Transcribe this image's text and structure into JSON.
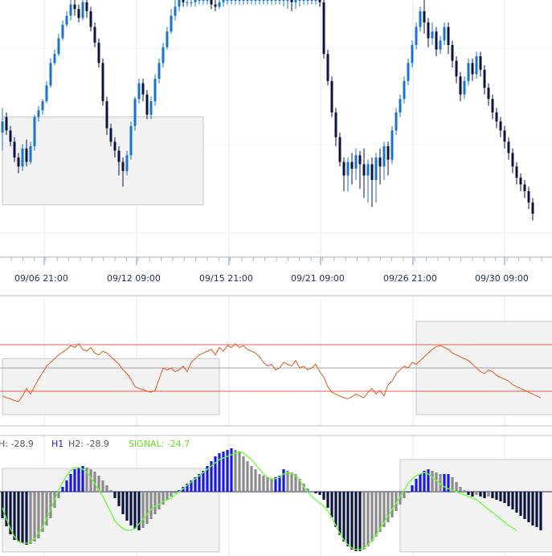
{
  "chart_data": [
    {
      "type": "candlestick",
      "x_tick_labels": [
        "09/06 21:00",
        "09/12 09:00",
        "09/15 21:00",
        "09/21 09:00",
        "09/26 21:00",
        "09/30 09:00"
      ],
      "colors": {
        "up": "#1874cd",
        "down": "#0b1445",
        "zone": "#f2f2f2",
        "zone_border": "#c8c8c8",
        "grid": "#e4e8ee"
      },
      "zones": [
        {
          "x_from": 0,
          "x_to": 50,
          "y_from": 9,
          "y_to": 48
        },
        {
          "x_from": 143,
          "x_to": 200,
          "y_from": 24,
          "y_to": 46
        }
      ],
      "candles": [
        [
          41,
          46,
          33,
          52
        ],
        [
          48,
          42,
          40,
          50
        ],
        [
          42,
          37,
          35,
          44
        ],
        [
          37,
          30,
          28,
          39
        ],
        [
          30,
          26,
          23,
          32
        ],
        [
          26,
          34,
          24,
          36
        ],
        [
          34,
          28,
          26,
          38
        ],
        [
          28,
          35,
          27,
          37
        ],
        [
          35,
          48,
          33,
          49
        ],
        [
          48,
          51,
          46,
          53
        ],
        [
          51,
          55,
          49,
          56
        ],
        [
          55,
          62,
          54,
          64
        ],
        [
          62,
          72,
          61,
          74
        ],
        [
          72,
          76,
          71,
          78
        ],
        [
          76,
          83,
          75,
          85
        ],
        [
          83,
          89,
          82,
          91
        ],
        [
          89,
          93,
          88,
          95
        ],
        [
          93,
          98,
          91,
          100
        ],
        [
          98,
          96,
          93,
          100
        ],
        [
          96,
          92,
          90,
          98
        ],
        [
          92,
          99,
          91,
          100
        ],
        [
          99,
          95,
          92,
          100
        ],
        [
          95,
          88,
          86,
          97
        ],
        [
          88,
          81,
          79,
          90
        ],
        [
          81,
          72,
          70,
          83
        ],
        [
          72,
          55,
          53,
          74
        ],
        [
          55,
          43,
          40,
          57
        ],
        [
          43,
          37,
          35,
          45
        ],
        [
          37,
          33,
          30,
          39
        ],
        [
          33,
          28,
          22,
          35
        ],
        [
          28,
          24,
          17,
          30
        ],
        [
          24,
          31,
          22,
          33
        ],
        [
          31,
          44,
          29,
          46
        ],
        [
          44,
          56,
          42,
          57
        ],
        [
          56,
          63,
          54,
          65
        ],
        [
          63,
          58,
          55,
          65
        ],
        [
          58,
          49,
          47,
          60
        ],
        [
          49,
          55,
          47,
          57
        ],
        [
          55,
          65,
          53,
          67
        ],
        [
          65,
          72,
          63,
          74
        ],
        [
          72,
          79,
          70,
          81
        ],
        [
          79,
          86,
          78,
          88
        ],
        [
          86,
          93,
          85,
          96
        ],
        [
          93,
          97,
          91,
          100
        ],
        [
          97,
          100,
          95,
          100
        ],
        [
          100,
          99,
          97,
          100
        ],
        [
          99,
          99,
          97,
          100
        ],
        [
          99,
          99,
          97,
          100
        ],
        [
          99,
          100,
          97,
          100
        ],
        [
          100,
          100,
          98,
          100
        ],
        [
          100,
          100,
          98,
          100
        ],
        [
          100,
          100,
          98,
          100
        ],
        [
          100,
          98,
          96,
          100
        ],
        [
          98,
          97,
          95,
          100
        ],
        [
          97,
          99,
          96,
          100
        ],
        [
          99,
          100,
          97,
          100
        ],
        [
          100,
          100,
          98,
          100
        ],
        [
          100,
          100,
          98,
          100
        ],
        [
          100,
          100,
          98,
          100
        ],
        [
          100,
          100,
          98,
          100
        ],
        [
          100,
          100,
          98,
          100
        ],
        [
          100,
          100,
          98,
          100
        ],
        [
          100,
          100,
          98,
          100
        ],
        [
          100,
          100,
          98,
          100
        ],
        [
          100,
          100,
          98,
          100
        ],
        [
          100,
          100,
          98,
          100
        ],
        [
          100,
          100,
          98,
          100
        ],
        [
          100,
          100,
          98,
          100
        ],
        [
          100,
          100,
          98,
          100
        ],
        [
          100,
          100,
          98,
          100
        ],
        [
          100,
          100,
          97,
          100
        ],
        [
          100,
          100,
          96,
          100
        ],
        [
          100,
          99,
          95,
          100
        ],
        [
          99,
          100,
          96,
          100
        ],
        [
          100,
          100,
          97,
          100
        ],
        [
          100,
          100,
          98,
          100
        ],
        [
          100,
          100,
          98,
          100
        ],
        [
          100,
          100,
          98,
          100
        ],
        [
          100,
          100,
          98,
          100
        ],
        [
          100,
          99,
          97,
          100
        ],
        [
          99,
          76,
          74,
          100
        ],
        [
          76,
          64,
          62,
          78
        ],
        [
          64,
          50,
          48,
          66
        ],
        [
          50,
          39,
          35,
          52
        ],
        [
          39,
          28,
          26,
          41
        ],
        [
          28,
          22,
          15,
          30
        ],
        [
          22,
          28,
          15,
          30
        ],
        [
          28,
          25,
          18,
          32
        ],
        [
          25,
          31,
          20,
          34
        ],
        [
          31,
          27,
          16,
          33
        ],
        [
          27,
          22,
          12,
          34
        ],
        [
          22,
          27,
          10,
          29
        ],
        [
          27,
          20,
          8,
          30
        ],
        [
          20,
          30,
          10,
          32
        ],
        [
          30,
          26,
          18,
          34
        ],
        [
          26,
          35,
          20,
          37
        ],
        [
          35,
          29,
          22,
          37
        ],
        [
          29,
          42,
          27,
          44
        ],
        [
          42,
          50,
          40,
          52
        ],
        [
          50,
          56,
          48,
          58
        ],
        [
          56,
          64,
          54,
          66
        ],
        [
          64,
          72,
          62,
          74
        ],
        [
          72,
          80,
          70,
          82
        ],
        [
          80,
          88,
          78,
          90
        ],
        [
          88,
          95,
          86,
          97
        ],
        [
          95,
          90,
          85,
          100
        ],
        [
          90,
          83,
          79,
          92
        ],
        [
          83,
          86,
          80,
          90
        ],
        [
          86,
          78,
          75,
          88
        ],
        [
          78,
          82,
          76,
          84
        ],
        [
          82,
          88,
          80,
          90
        ],
        [
          88,
          80,
          76,
          90
        ],
        [
          80,
          73,
          70,
          82
        ],
        [
          73,
          66,
          63,
          75
        ],
        [
          66,
          58,
          55,
          68
        ],
        [
          58,
          64,
          56,
          66
        ],
        [
          64,
          72,
          62,
          74
        ],
        [
          72,
          67,
          64,
          74
        ],
        [
          67,
          75,
          65,
          77
        ],
        [
          75,
          69,
          66,
          77
        ],
        [
          69,
          61,
          58,
          71
        ],
        [
          61,
          56,
          53,
          63
        ],
        [
          56,
          50,
          47,
          58
        ],
        [
          50,
          46,
          43,
          52
        ],
        [
          46,
          42,
          39,
          48
        ],
        [
          42,
          37,
          34,
          44
        ],
        [
          37,
          32,
          29,
          39
        ],
        [
          32,
          26,
          23,
          34
        ],
        [
          26,
          21,
          18,
          28
        ],
        [
          21,
          18,
          15,
          23
        ],
        [
          18,
          15,
          12,
          20
        ],
        [
          15,
          10,
          7,
          17
        ],
        [
          10,
          5,
          2,
          12
        ]
      ]
    },
    {
      "type": "line",
      "colors": {
        "line": "#e05a1e",
        "level": "#e06050"
      },
      "levels": [
        75,
        25
      ],
      "ylim": [
        0,
        100
      ],
      "zones": [
        {
          "x_from": 0,
          "x_to": 54,
          "y_from": 0,
          "y_to": 60
        },
        {
          "x_from": 103,
          "x_to": 175,
          "y_from": 0,
          "y_to": 100
        }
      ],
      "values": [
        20,
        18,
        17,
        15,
        14,
        20,
        28,
        22,
        30,
        38,
        45,
        52,
        56,
        60,
        64,
        67,
        70,
        74,
        72,
        76,
        70,
        68,
        72,
        66,
        64,
        68,
        66,
        62,
        58,
        54,
        48,
        44,
        38,
        30,
        28,
        27,
        25,
        24,
        26,
        38,
        50,
        48,
        50,
        46,
        48,
        52,
        46,
        56,
        60,
        64,
        66,
        68,
        70,
        64,
        72,
        68,
        74,
        72,
        76,
        72,
        74,
        70,
        68,
        66,
        62,
        56,
        52,
        54,
        48,
        50,
        56,
        54,
        52,
        58,
        50,
        52,
        48,
        50,
        54,
        46,
        40,
        30,
        24,
        22,
        20,
        18,
        17,
        19,
        22,
        20,
        18,
        24,
        28,
        22,
        26,
        20,
        32,
        36,
        44,
        48,
        52,
        50,
        56,
        54,
        58,
        62,
        66,
        70,
        73,
        74,
        72,
        70,
        66,
        64,
        62,
        60,
        58,
        54,
        50,
        46,
        44,
        48,
        46,
        42,
        40,
        38,
        36,
        32,
        30,
        28,
        26,
        24,
        22,
        20,
        18
      ]
    },
    {
      "type": "histogram",
      "legend": {
        "prefix": "H: -28.9",
        "h1_label": "H1",
        "h2_label": "H2: -28.9",
        "signal_label": "SIGNAL: -24.7"
      },
      "colors": {
        "strong": "#1a1adc",
        "weak": "#8a8a8a",
        "neg_strong": "#0b1445",
        "signal": "#66ff33",
        "zero": "#1a2a6a"
      },
      "ylim": [
        -78,
        60
      ],
      "zones": [
        {
          "x_from": 0,
          "x_to": 54,
          "y_from": -75,
          "y_to": 29
        },
        {
          "x_from": 99,
          "x_to": 175,
          "y_from": -75,
          "y_to": 40
        }
      ],
      "bars": [
        -33,
        -43,
        -53,
        -60,
        -62,
        -64,
        -66,
        -65,
        -62,
        -58,
        -50,
        -42,
        -33,
        -20,
        -8,
        6,
        14,
        22,
        28,
        30,
        32,
        30,
        28,
        25,
        20,
        14,
        8,
        2,
        -8,
        -18,
        -28,
        -36,
        -42,
        -46,
        -48,
        -45,
        -40,
        -34,
        -28,
        -22,
        -16,
        -10,
        -6,
        -2,
        2,
        6,
        10,
        14,
        18,
        22,
        26,
        32,
        38,
        44,
        48,
        50,
        52,
        54,
        52,
        50,
        44,
        38,
        32,
        28,
        22,
        20,
        18,
        16,
        18,
        20,
        28,
        26,
        24,
        22,
        16,
        10,
        4,
        0,
        -2,
        -4,
        -10,
        -20,
        -32,
        -44,
        -54,
        -62,
        -68,
        -72,
        -74,
        -74,
        -72,
        -68,
        -62,
        -56,
        -50,
        -44,
        -38,
        -32,
        -24,
        -16,
        -8,
        0,
        8,
        16,
        22,
        26,
        28,
        26,
        24,
        22,
        22,
        22,
        18,
        12,
        6,
        2,
        -4,
        -6,
        -4,
        -6,
        -8,
        -6,
        -8,
        -10,
        -12,
        -14,
        -18,
        -22,
        -26,
        -30,
        -34,
        -38,
        -42,
        -44,
        -48
      ],
      "signal": [
        -20,
        -34,
        -46,
        -56,
        -62,
        -64,
        -64,
        -62,
        -58,
        -52,
        -44,
        -34,
        -22,
        -10,
        2,
        12,
        20,
        26,
        30,
        30,
        28,
        24,
        18,
        10,
        2,
        -6,
        -16,
        -26,
        -36,
        -42,
        -46,
        -48,
        -48,
        -46,
        -40,
        -34,
        -28,
        -22,
        -18,
        -16,
        -12,
        -10,
        -8,
        -4,
        0,
        4,
        8,
        12,
        16,
        20,
        24,
        28,
        32,
        36,
        40,
        42,
        44,
        46,
        48,
        50,
        48,
        44,
        40,
        34,
        28,
        22,
        18,
        16,
        16,
        18,
        22,
        24,
        22,
        20,
        14,
        6,
        0,
        -6,
        -10,
        -14,
        -18,
        -24,
        -32,
        -42,
        -52,
        -60,
        -66,
        -70,
        -72,
        -72,
        -70,
        -66,
        -60,
        -54,
        -46,
        -38,
        -30,
        -22,
        -14,
        -6,
        2,
        10,
        16,
        20,
        22,
        24,
        22,
        18,
        14,
        10,
        6,
        4,
        2,
        0,
        -2,
        -4,
        -6,
        -8,
        -10,
        -14,
        -18,
        -22,
        -26,
        -30,
        -34,
        -38,
        -42,
        -45,
        -48
      ]
    }
  ]
}
